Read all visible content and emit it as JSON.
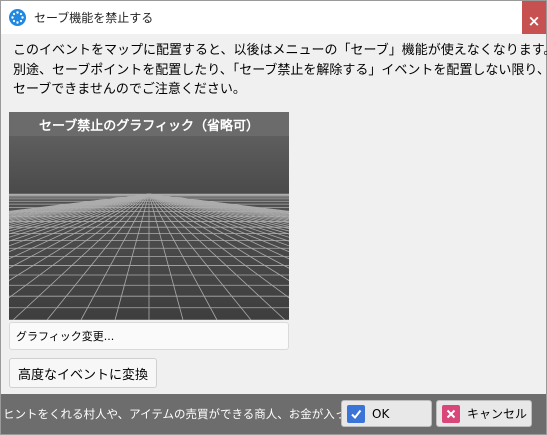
{
  "window": {
    "title": "セーブ機能を禁止する",
    "close_label": "×"
  },
  "description": {
    "line1": "このイベントをマップに配置すると、以後はメニューの「セーブ」機能が使えなくなります。",
    "line2": "別途、セーブポイントを配置したり、「セーブ禁止を解除する」イベントを配置しない限り、",
    "line3": "セーブできませんのでご注意ください。"
  },
  "graphic": {
    "header": "セーブ禁止のグラフィック（省略可）",
    "change_label": "グラフィック変更..."
  },
  "convert_button": "高度なイベントに変換",
  "footer": {
    "hint": "ヒントをくれる村人や、アイテムの売買ができる商人、お金が入っ",
    "ok_label": "OK",
    "cancel_label": "キャンセル"
  },
  "colors": {
    "accent": "#1e88e5",
    "close": "#c75050",
    "ok_check": "#3a74d6",
    "cancel_x": "#d9467a",
    "footer_bg": "#6d6d6d"
  }
}
